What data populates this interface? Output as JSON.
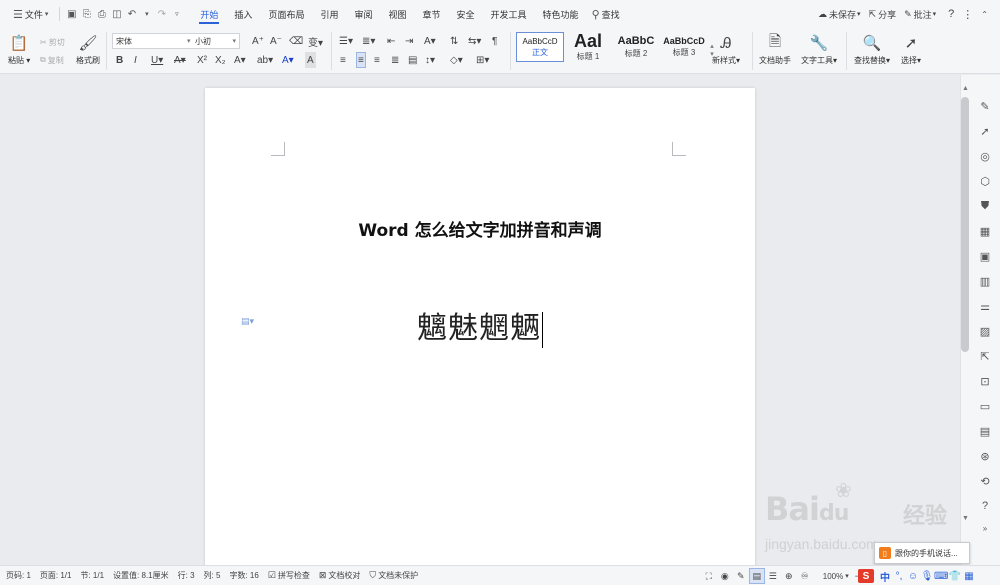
{
  "menubar": {
    "file_label": "文件",
    "tabs": [
      {
        "label": "开始",
        "active": true
      },
      {
        "label": "插入"
      },
      {
        "label": "页面布局"
      },
      {
        "label": "引用"
      },
      {
        "label": "审阅"
      },
      {
        "label": "视图"
      },
      {
        "label": "章节"
      },
      {
        "label": "安全"
      },
      {
        "label": "开发工具"
      },
      {
        "label": "特色功能"
      }
    ],
    "search_label": "查找",
    "unsaved_label": "未保存",
    "share_label": "分享",
    "comment_label": "批注",
    "help_label": "?"
  },
  "ribbon": {
    "paste_label": "粘贴",
    "cut_label": "剪切",
    "copy_label": "复制",
    "format_painter_label": "格式刷",
    "font_name": "宋体",
    "font_size": "小初",
    "styles": [
      {
        "sample": "AaBbCcD",
        "name": "正文",
        "active": true
      },
      {
        "sample": "Aal",
        "name": "标题 1"
      },
      {
        "sample": "AaBbC",
        "name": "标题 2"
      },
      {
        "sample": "AaBbCcD",
        "name": "标题 3"
      }
    ],
    "new_style_label": "新样式",
    "doc_assistant_label": "文档助手",
    "text_tools_label": "文字工具",
    "find_replace_label": "查找替换",
    "select_label": "选择"
  },
  "document": {
    "title": "Word 怎么给文字加拼音和声调",
    "characters": "魑魅魍魉"
  },
  "statusbar": {
    "page_no": "页码: 1",
    "pages": "页面: 1/1",
    "section": "节: 1/1",
    "position": "设置值: 8.1厘米",
    "row": "行: 3",
    "column": "列: 5",
    "word_count": "字数: 16",
    "spell_check": "拼写检查",
    "doc_proof": "文档校对",
    "doc_protect": "文档未保护",
    "zoom": "100%"
  },
  "popup": {
    "phone_text": "跟你的手机说话..."
  },
  "watermark": {
    "brand": "Bai",
    "brand2": "du",
    "sub": "经验",
    "url": "jingyan.baidu.com"
  },
  "colors": {
    "accent": "#2b62d8",
    "ime_red": "#e43a2a"
  }
}
